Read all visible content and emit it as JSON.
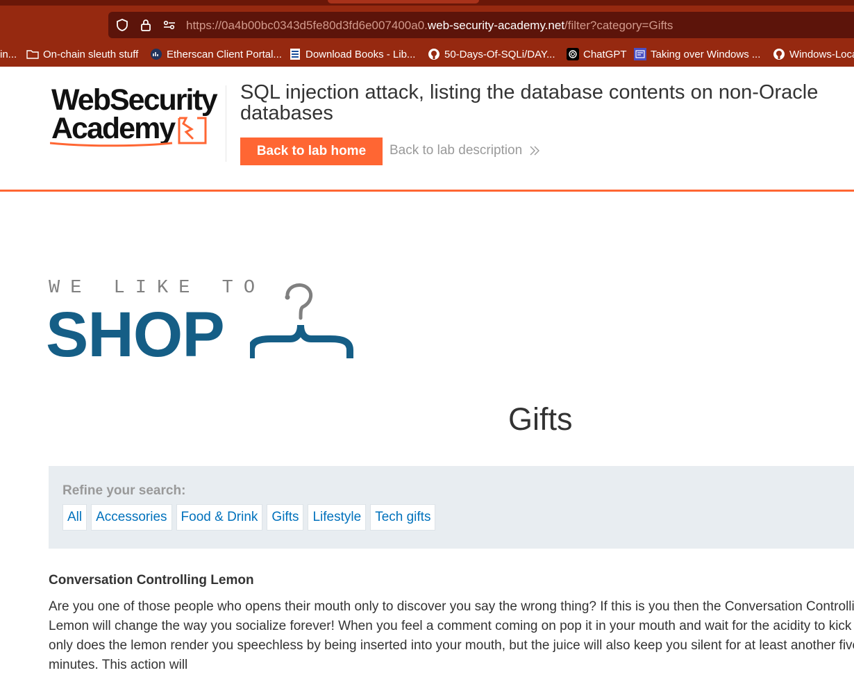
{
  "browser": {
    "url_prefix": "https://0a4b00bc0343d5fe80d3fd6e007400a0.",
    "url_host": "web-security-academy.net",
    "url_path": "/filter?category=Gifts",
    "icons": [
      "shield-icon",
      "lock-icon",
      "permissions-icon"
    ],
    "bookmarks": [
      {
        "label": "in...",
        "icon": "none"
      },
      {
        "label": "On-chain sleuth stuff",
        "icon": "folder-icon"
      },
      {
        "label": "Etherscan Client Portal...",
        "icon": "etherscan-icon"
      },
      {
        "label": "Download Books - Lib...",
        "icon": "book-icon"
      },
      {
        "label": "50-Days-Of-SQLi/DAY...",
        "icon": "github-icon"
      },
      {
        "label": "ChatGPT",
        "icon": "chatgpt-icon"
      },
      {
        "label": "Taking over Windows ...",
        "icon": "site-icon"
      },
      {
        "label": "Windows-Loca",
        "icon": "github-icon"
      }
    ]
  },
  "lab": {
    "logo_line1": "WebSecurity",
    "logo_line2": "Academy",
    "title": "SQL injection attack, listing the database contents on non-Oracle databases",
    "back_home_label": "Back to lab home",
    "back_desc_label": "Back to lab description"
  },
  "shop": {
    "tagline": "WE LIKE TO",
    "wordmark": "SHOP",
    "heading": "Gifts",
    "refine_label": "Refine your search:",
    "filters": [
      "All",
      "Accessories",
      "Food & Drink",
      "Gifts",
      "Lifestyle",
      "Tech gifts"
    ],
    "product": {
      "name": "Conversation Controlling Lemon",
      "description": "Are you one of those people who opens their mouth only to discover you say the wrong thing? If this is you then the Conversation Controlling Lemon will change the way you socialize forever! When you feel a comment coming on pop it in your mouth and wait for the acidity to kick in. Not only does the lemon render you speechless by being inserted into your mouth, but the juice will also keep you silent for at least another five minutes. This action will"
    }
  },
  "colors": {
    "chrome_bg": "#962910",
    "urlbar_bg": "#5c140a",
    "accent_orange": "#ff6633",
    "shop_blue": "#155e86",
    "link_blue": "#0071bc",
    "filter_bg": "#e8edf1"
  }
}
